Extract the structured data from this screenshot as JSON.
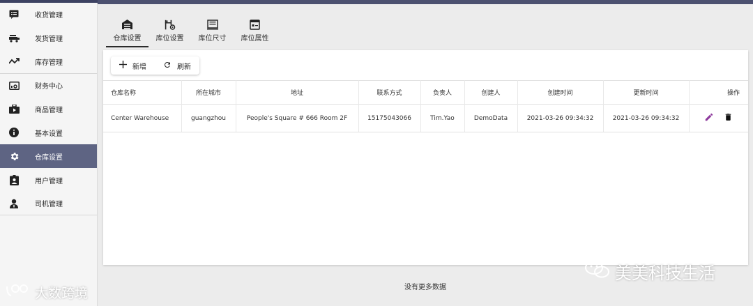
{
  "sidebar": {
    "items": [
      {
        "label": "收货管理",
        "icon": "receipt-icon"
      },
      {
        "label": "发货管理",
        "icon": "truck-icon"
      },
      {
        "label": "库存管理",
        "icon": "trend-icon"
      },
      {
        "label": "财务中心",
        "icon": "finance-icon"
      },
      {
        "label": "商品管理",
        "icon": "goods-icon"
      },
      {
        "label": "基本设置",
        "icon": "info-icon"
      },
      {
        "label": "仓库设置",
        "icon": "gear-icon"
      },
      {
        "label": "用户管理",
        "icon": "user-badge-icon"
      },
      {
        "label": "司机管理",
        "icon": "driver-icon"
      }
    ],
    "active_index": 6,
    "watermark": "大数跨境"
  },
  "tabs": [
    {
      "label": "仓库设置",
      "icon": "warehouse-icon"
    },
    {
      "label": "库位设置",
      "icon": "location-settings-icon"
    },
    {
      "label": "库位尺寸",
      "icon": "location-size-icon"
    },
    {
      "label": "库位属性",
      "icon": "location-attr-icon"
    }
  ],
  "toolbar": {
    "add_label": "新增",
    "refresh_label": "刷新"
  },
  "table": {
    "headers": [
      "仓库名称",
      "所在城市",
      "地址",
      "联系方式",
      "负责人",
      "创建人",
      "创建时间",
      "更新时间",
      "操作"
    ],
    "rows": [
      [
        "Center Warehouse",
        "guangzhou",
        "People's Square # 666 Room 2F",
        "15175043066",
        "Tim.Yao",
        "DemoData",
        "2021-03-26 09:34:32",
        "2021-03-26 09:34:32"
      ]
    ]
  },
  "footer": {
    "no_more": "没有更多数据"
  },
  "watermark_right": "美美科技生活",
  "colors": {
    "active_bg": "#5e6483",
    "edit": "#8e3a9d",
    "topbar": "#4c5170"
  }
}
